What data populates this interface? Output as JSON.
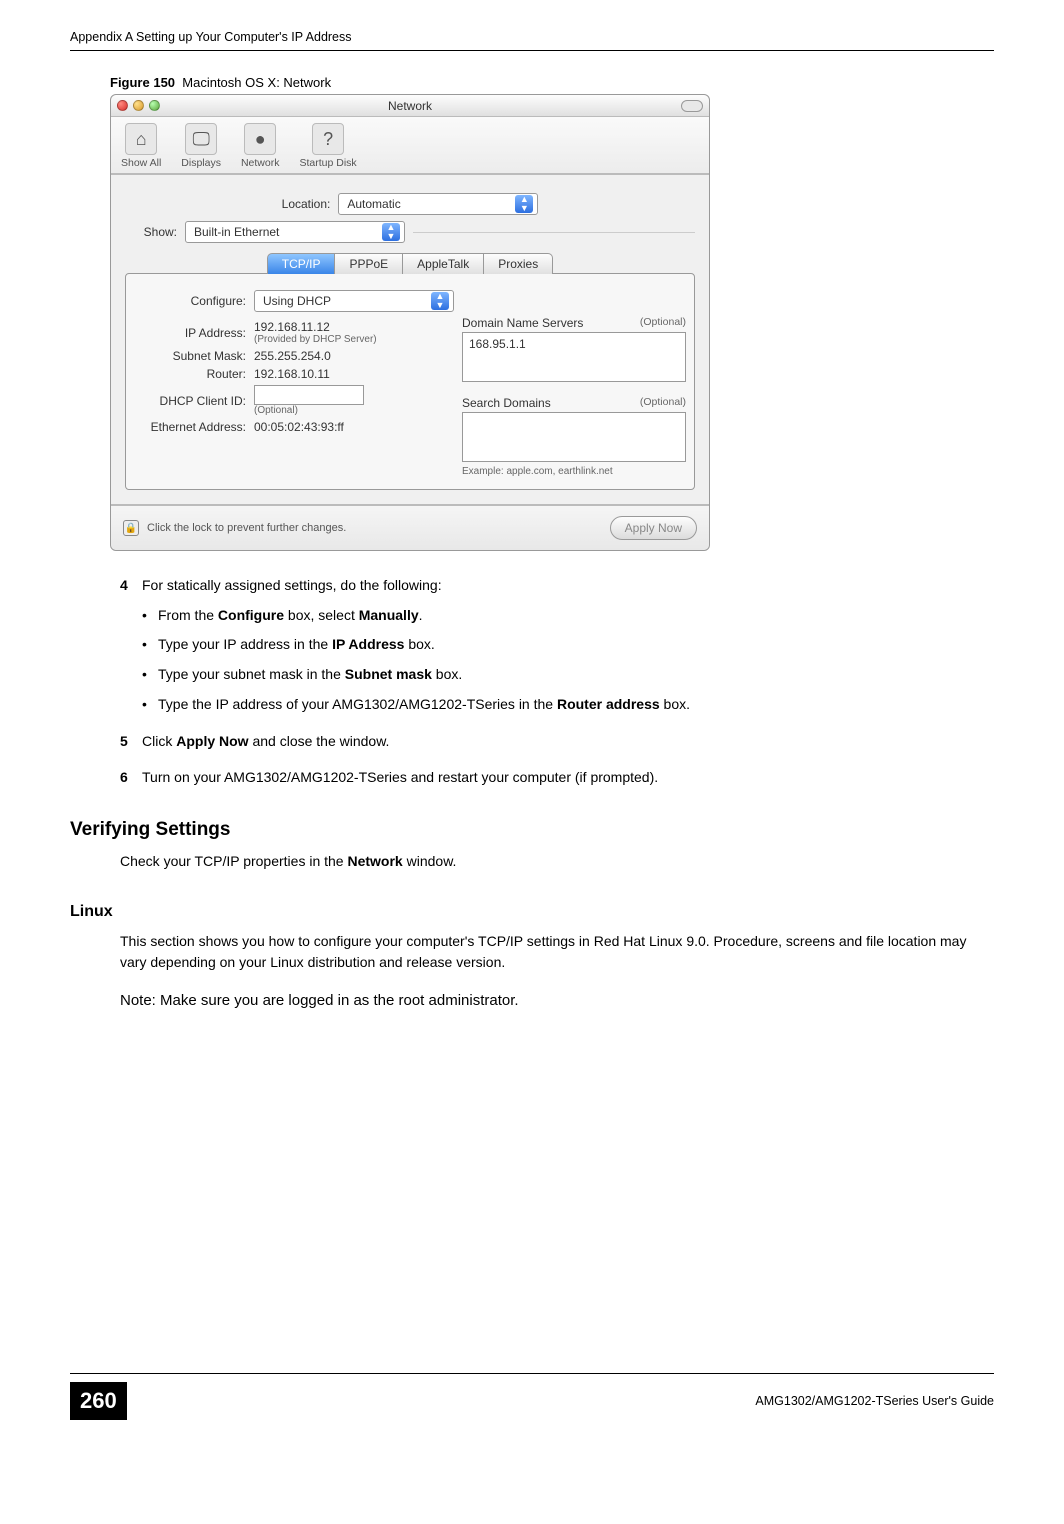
{
  "header": "Appendix A Setting up Your Computer's IP Address",
  "figure": {
    "label": "Figure 150",
    "caption": "Macintosh OS X: Network"
  },
  "mac": {
    "title": "Network",
    "toolbar": {
      "show_all_label": "Show All",
      "displays_label": "Displays",
      "network_label": "Network",
      "startup_label": "Startup Disk"
    },
    "location_label": "Location:",
    "location_value": "Automatic",
    "show_label": "Show:",
    "show_value": "Built-in Ethernet",
    "tabs": {
      "tcpip": "TCP/IP",
      "pppoe": "PPPoE",
      "appletalk": "AppleTalk",
      "proxies": "Proxies"
    },
    "configure_label": "Configure:",
    "configure_value": "Using DHCP",
    "ip_label": "IP Address:",
    "ip_value": "192.168.11.12",
    "ip_sub": "(Provided by DHCP Server)",
    "subnet_label": "Subnet Mask:",
    "subnet_value": "255.255.254.0",
    "router_label": "Router:",
    "router_value": "192.168.10.11",
    "dhcp_label": "DHCP Client ID:",
    "dhcp_sub": "(Optional)",
    "eth_label": "Ethernet Address:",
    "eth_value": "00:05:02:43:93:ff",
    "dns_label": "Domain Name Servers",
    "dns_optional": "(Optional)",
    "dns_value": "168.95.1.1",
    "search_label": "Search Domains",
    "search_optional": "(Optional)",
    "search_example": "Example: apple.com, earthlink.net",
    "lock_text": "Click the lock to prevent further changes.",
    "apply_label": "Apply Now"
  },
  "steps": {
    "s4_intro": "For statically assigned settings, do the following:",
    "b1_pre": "From the ",
    "b1_bold": "Configure",
    "b1_mid": " box, select ",
    "b1_bold2": "Manually",
    "b1_post": ".",
    "b2_pre": "Type your IP address in the ",
    "b2_bold": "IP Address",
    "b2_post": " box.",
    "b3_pre": "Type your subnet mask in the ",
    "b3_bold": "Subnet mask",
    "b3_post": " box.",
    "b4_pre": "Type the IP address of your AMG1302/AMG1202-TSeries in the ",
    "b4_bold": "Router address",
    "b4_post": " box.",
    "s5_pre": "Click ",
    "s5_bold": "Apply Now",
    "s5_post": " and close the window.",
    "s6": "Turn on your AMG1302/AMG1202-TSeries and restart your computer (if prompted).",
    "num4": "4",
    "num5": "5",
    "num6": "6"
  },
  "verify": {
    "heading": "Verifying Settings",
    "text_pre": "Check your TCP/IP properties in the ",
    "text_bold": "Network",
    "text_post": " window."
  },
  "linux": {
    "heading": "Linux",
    "para": "This section shows you how to configure your computer's TCP/IP settings in Red Hat Linux 9.0. Procedure, screens and file location may vary depending on your Linux distribution and release version.",
    "note": "Note: Make sure you are logged in as the root administrator."
  },
  "footer": {
    "page": "260",
    "guide": "AMG1302/AMG1202-TSeries User's Guide"
  }
}
